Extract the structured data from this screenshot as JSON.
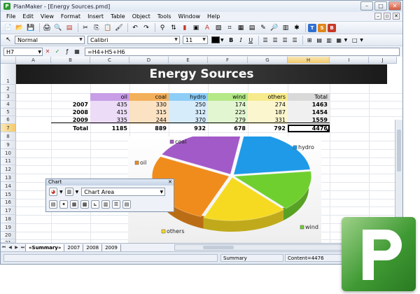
{
  "window": {
    "app_name": "PlanMaker",
    "title": "PlanMaker - [Energy Sources.pmd]"
  },
  "menu": [
    "File",
    "Edit",
    "View",
    "Format",
    "Insert",
    "Table",
    "Object",
    "Tools",
    "Window",
    "Help"
  ],
  "format_bar": {
    "style": "Normal",
    "font": "Calibri",
    "size": "11"
  },
  "formula_bar": {
    "cell_ref": "H7",
    "formula": "=H4+H5+H6"
  },
  "columns": [
    "A",
    "B",
    "C",
    "D",
    "E",
    "F",
    "G",
    "H",
    "I",
    "J"
  ],
  "rows": [
    "1",
    "2",
    "3",
    "4",
    "5",
    "6",
    "7",
    "8",
    "9",
    "10",
    "11",
    "12",
    "13",
    "14",
    "15",
    "16",
    "17",
    "18",
    "19",
    "20",
    "21"
  ],
  "sheet": {
    "title": "Energy Sources",
    "headers": [
      "oil",
      "coal",
      "hydro",
      "wind",
      "others",
      "Total"
    ],
    "data_rows": [
      {
        "label": "2007",
        "values": [
          "435",
          "330",
          "250",
          "174",
          "274",
          "1463"
        ]
      },
      {
        "label": "2008",
        "values": [
          "415",
          "315",
          "312",
          "225",
          "187",
          "1454"
        ]
      },
      {
        "label": "2009",
        "values": [
          "335",
          "244",
          "370",
          "279",
          "331",
          "1559"
        ]
      }
    ],
    "total_row": {
      "label": "Total",
      "values": [
        "1185",
        "889",
        "932",
        "678",
        "792",
        "4476"
      ]
    }
  },
  "chart_data": {
    "type": "pie",
    "categories": [
      "oil",
      "coal",
      "hydro",
      "wind",
      "others"
    ],
    "values": [
      1185,
      889,
      932,
      678,
      792
    ],
    "labels": [
      "oil",
      "coal",
      "hydro",
      "wind",
      "others"
    ],
    "colors": [
      "#f08c1c",
      "#a25ac8",
      "#1e9ae8",
      "#6fcf2f",
      "#f6da22"
    ]
  },
  "chart_toolbar": {
    "title": "Chart",
    "element_select": "Chart Area"
  },
  "tabs": [
    "«Summary»",
    "2007",
    "2008",
    "2009"
  ],
  "status": {
    "sheet_name": "Summary",
    "content": "Content=4476"
  },
  "logo_letter": "P",
  "colors": {
    "oil": "#c89ee6",
    "coal": "#f3b05b",
    "hydro": "#8ecdf6",
    "wind": "#b5e887",
    "others": "#f6ea8c",
    "total": "#d9d9d9",
    "oil_light": "#ecdcf7",
    "coal_light": "#fbe2c2",
    "hydro_light": "#d7ecfb",
    "wind_light": "#e3f6d2",
    "others_light": "#fcf6cf",
    "total_light": "#f0f0f0"
  }
}
